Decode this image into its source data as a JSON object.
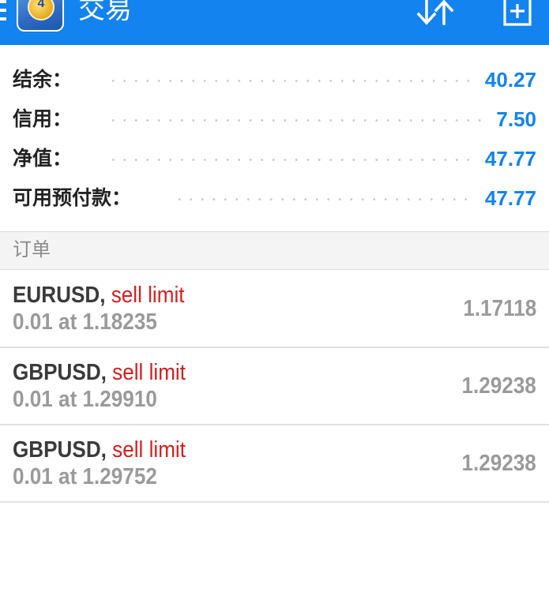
{
  "app_bar": {
    "title": "交易",
    "menu_icon": "menu-icon",
    "logo_badge": "4",
    "sort_icon": "sort-icon",
    "new_order_icon": "add-order-icon",
    "color": "#1283ef"
  },
  "account": {
    "rows": [
      {
        "label": "结余：",
        "value": "40.27"
      },
      {
        "label": "信用：",
        "value": "7.50"
      },
      {
        "label": "净值：",
        "value": "47.77"
      },
      {
        "label": "可用预付款：",
        "value": "47.77"
      }
    ],
    "value_color": "#1283ef"
  },
  "orders": {
    "section_title": "订单",
    "items": [
      {
        "symbol": "EURUSD,",
        "type": "sell limit",
        "detail": "0.01 at 1.18235",
        "price": "1.17118"
      },
      {
        "symbol": "GBPUSD,",
        "type": "sell limit",
        "detail": "0.01 at 1.29910",
        "price": "1.29238"
      },
      {
        "symbol": "GBPUSD,",
        "type": "sell limit",
        "detail": "0.01 at 1.29752",
        "price": "1.29238"
      }
    ],
    "type_color": "#d32020"
  }
}
